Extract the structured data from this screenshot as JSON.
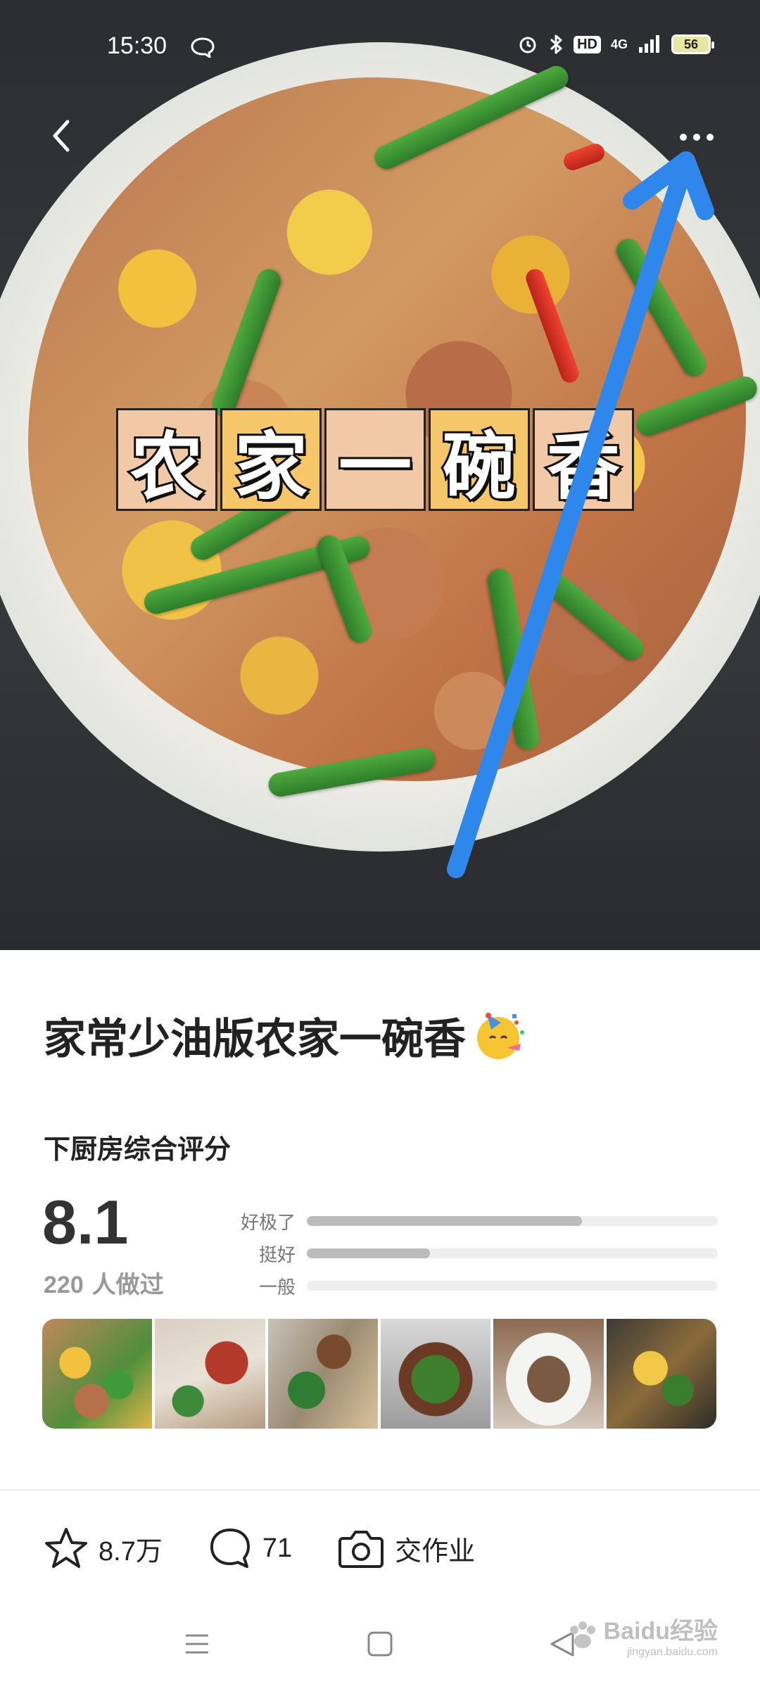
{
  "status_bar": {
    "time": "15:30",
    "hd_badge": "HD",
    "network": "4G",
    "battery": "56"
  },
  "hero": {
    "overlay_chars": [
      "农",
      "家",
      "一",
      "碗",
      "香"
    ],
    "back_icon": "chevron-left-icon",
    "more_icon": "more-dots-icon",
    "annotation_color": "#2f86eb"
  },
  "recipe": {
    "title": "家常少油版农家一碗香",
    "title_emoji_icon": "party-face-icon"
  },
  "rating": {
    "label": "下厨房综合评分",
    "score": "8.1",
    "made_count": "220",
    "made_suffix": " 人做过",
    "bars": [
      {
        "label": "好极了",
        "fraction": 0.67
      },
      {
        "label": "挺好",
        "fraction": 0.3
      },
      {
        "label": "一般",
        "fraction": 0.0
      }
    ]
  },
  "gallery": {
    "thumb_count": 6
  },
  "actions": {
    "favorites": "8.7万",
    "comments": "71",
    "homework": "交作业"
  },
  "watermark": {
    "text": "Baidu经验",
    "sub": "jingyan.baidu.com"
  },
  "colors": {
    "accent_arrow": "#2f86eb",
    "bar_fill": "#bcbcbc",
    "bar_track": "#eeeeee"
  }
}
